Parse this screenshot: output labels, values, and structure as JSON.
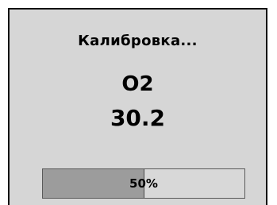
{
  "screen": {
    "title": "Калибровка...",
    "sensor_label": "O2",
    "sensor_value": "30.2"
  },
  "progress": {
    "percent": 50,
    "label": "50%"
  },
  "colors": {
    "background": "#d6d6d6",
    "bar_fill": "#9c9c9c",
    "bar_track": "#d8d8d8"
  }
}
